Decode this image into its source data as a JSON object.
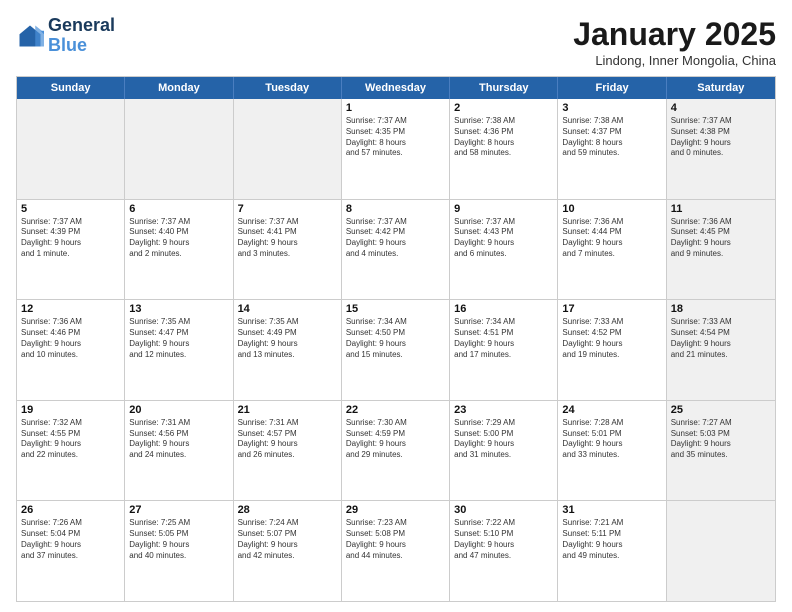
{
  "logo": {
    "line1": "General",
    "line2": "Blue"
  },
  "title": "January 2025",
  "subtitle": "Lindong, Inner Mongolia, China",
  "header_days": [
    "Sunday",
    "Monday",
    "Tuesday",
    "Wednesday",
    "Thursday",
    "Friday",
    "Saturday"
  ],
  "rows": [
    [
      {
        "day": "",
        "text": "",
        "shaded": true
      },
      {
        "day": "",
        "text": "",
        "shaded": true
      },
      {
        "day": "",
        "text": "",
        "shaded": true
      },
      {
        "day": "1",
        "text": "Sunrise: 7:37 AM\nSunset: 4:35 PM\nDaylight: 8 hours\nand 57 minutes."
      },
      {
        "day": "2",
        "text": "Sunrise: 7:38 AM\nSunset: 4:36 PM\nDaylight: 8 hours\nand 58 minutes."
      },
      {
        "day": "3",
        "text": "Sunrise: 7:38 AM\nSunset: 4:37 PM\nDaylight: 8 hours\nand 59 minutes."
      },
      {
        "day": "4",
        "text": "Sunrise: 7:37 AM\nSunset: 4:38 PM\nDaylight: 9 hours\nand 0 minutes.",
        "shaded": true
      }
    ],
    [
      {
        "day": "5",
        "text": "Sunrise: 7:37 AM\nSunset: 4:39 PM\nDaylight: 9 hours\nand 1 minute."
      },
      {
        "day": "6",
        "text": "Sunrise: 7:37 AM\nSunset: 4:40 PM\nDaylight: 9 hours\nand 2 minutes."
      },
      {
        "day": "7",
        "text": "Sunrise: 7:37 AM\nSunset: 4:41 PM\nDaylight: 9 hours\nand 3 minutes."
      },
      {
        "day": "8",
        "text": "Sunrise: 7:37 AM\nSunset: 4:42 PM\nDaylight: 9 hours\nand 4 minutes."
      },
      {
        "day": "9",
        "text": "Sunrise: 7:37 AM\nSunset: 4:43 PM\nDaylight: 9 hours\nand 6 minutes."
      },
      {
        "day": "10",
        "text": "Sunrise: 7:36 AM\nSunset: 4:44 PM\nDaylight: 9 hours\nand 7 minutes."
      },
      {
        "day": "11",
        "text": "Sunrise: 7:36 AM\nSunset: 4:45 PM\nDaylight: 9 hours\nand 9 minutes.",
        "shaded": true
      }
    ],
    [
      {
        "day": "12",
        "text": "Sunrise: 7:36 AM\nSunset: 4:46 PM\nDaylight: 9 hours\nand 10 minutes."
      },
      {
        "day": "13",
        "text": "Sunrise: 7:35 AM\nSunset: 4:47 PM\nDaylight: 9 hours\nand 12 minutes."
      },
      {
        "day": "14",
        "text": "Sunrise: 7:35 AM\nSunset: 4:49 PM\nDaylight: 9 hours\nand 13 minutes."
      },
      {
        "day": "15",
        "text": "Sunrise: 7:34 AM\nSunset: 4:50 PM\nDaylight: 9 hours\nand 15 minutes."
      },
      {
        "day": "16",
        "text": "Sunrise: 7:34 AM\nSunset: 4:51 PM\nDaylight: 9 hours\nand 17 minutes."
      },
      {
        "day": "17",
        "text": "Sunrise: 7:33 AM\nSunset: 4:52 PM\nDaylight: 9 hours\nand 19 minutes."
      },
      {
        "day": "18",
        "text": "Sunrise: 7:33 AM\nSunset: 4:54 PM\nDaylight: 9 hours\nand 21 minutes.",
        "shaded": true
      }
    ],
    [
      {
        "day": "19",
        "text": "Sunrise: 7:32 AM\nSunset: 4:55 PM\nDaylight: 9 hours\nand 22 minutes."
      },
      {
        "day": "20",
        "text": "Sunrise: 7:31 AM\nSunset: 4:56 PM\nDaylight: 9 hours\nand 24 minutes."
      },
      {
        "day": "21",
        "text": "Sunrise: 7:31 AM\nSunset: 4:57 PM\nDaylight: 9 hours\nand 26 minutes."
      },
      {
        "day": "22",
        "text": "Sunrise: 7:30 AM\nSunset: 4:59 PM\nDaylight: 9 hours\nand 29 minutes."
      },
      {
        "day": "23",
        "text": "Sunrise: 7:29 AM\nSunset: 5:00 PM\nDaylight: 9 hours\nand 31 minutes."
      },
      {
        "day": "24",
        "text": "Sunrise: 7:28 AM\nSunset: 5:01 PM\nDaylight: 9 hours\nand 33 minutes."
      },
      {
        "day": "25",
        "text": "Sunrise: 7:27 AM\nSunset: 5:03 PM\nDaylight: 9 hours\nand 35 minutes.",
        "shaded": true
      }
    ],
    [
      {
        "day": "26",
        "text": "Sunrise: 7:26 AM\nSunset: 5:04 PM\nDaylight: 9 hours\nand 37 minutes."
      },
      {
        "day": "27",
        "text": "Sunrise: 7:25 AM\nSunset: 5:05 PM\nDaylight: 9 hours\nand 40 minutes."
      },
      {
        "day": "28",
        "text": "Sunrise: 7:24 AM\nSunset: 5:07 PM\nDaylight: 9 hours\nand 42 minutes."
      },
      {
        "day": "29",
        "text": "Sunrise: 7:23 AM\nSunset: 5:08 PM\nDaylight: 9 hours\nand 44 minutes."
      },
      {
        "day": "30",
        "text": "Sunrise: 7:22 AM\nSunset: 5:10 PM\nDaylight: 9 hours\nand 47 minutes."
      },
      {
        "day": "31",
        "text": "Sunrise: 7:21 AM\nSunset: 5:11 PM\nDaylight: 9 hours\nand 49 minutes."
      },
      {
        "day": "",
        "text": "",
        "shaded": true
      }
    ]
  ]
}
